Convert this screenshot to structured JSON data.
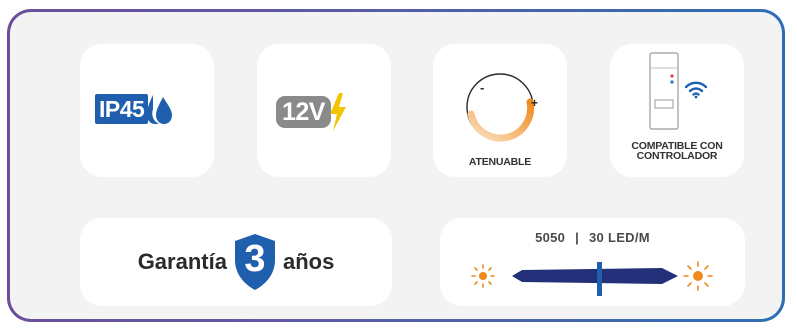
{
  "badges": {
    "ip_rating": "IP45",
    "voltage": "12V",
    "dimmable_label": "ATENUABLE",
    "dimmer_minus": "-",
    "dimmer_plus": "+",
    "controller_label_line1": "COMPATIBLE CON",
    "controller_label_line2": "CONTROLADOR"
  },
  "warranty": {
    "prefix": "Garantía",
    "years": "3",
    "suffix": "años"
  },
  "strip": {
    "spec_led_type": "5050",
    "spec_separator": "|",
    "spec_density": "30 LED/M"
  },
  "colors": {
    "frame_start": "#6b4e99",
    "frame_end": "#2d6fb5",
    "ip_blue": "#1f5fae",
    "bolt_yellow": "#f5c400",
    "warm_orange": "#f08a1c",
    "strip_navy": "#25307a"
  }
}
